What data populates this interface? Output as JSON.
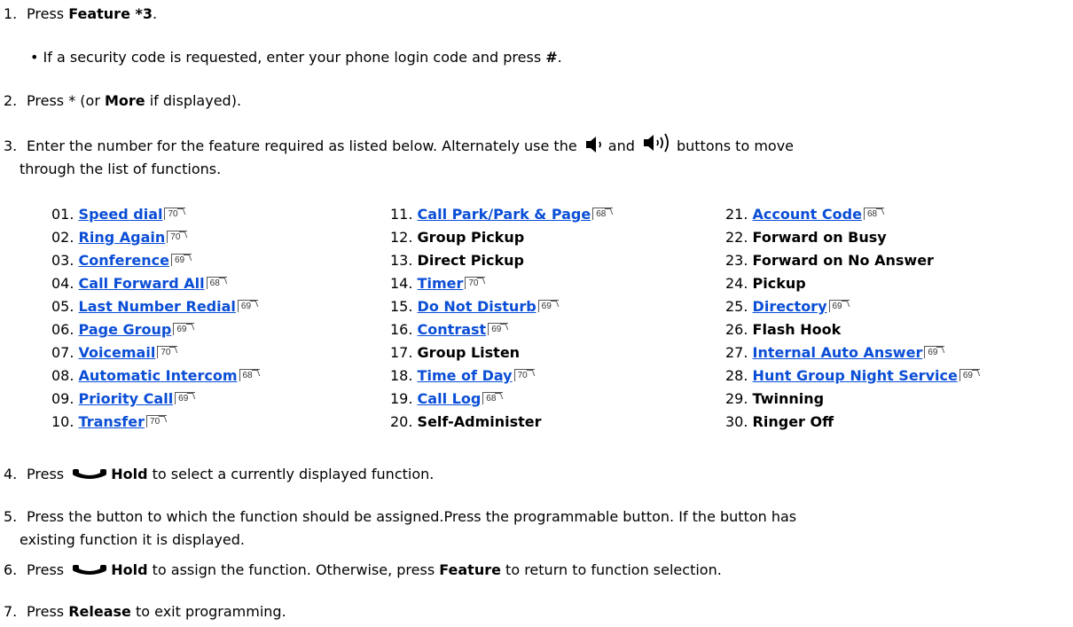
{
  "steps": {
    "s1": {
      "num": "1.",
      "pre": "Press ",
      "bold": "Feature *3",
      "post": "."
    },
    "s1_bullet": {
      "pre": "If a security code is requested, enter your phone login code and press ",
      "bold": "#",
      "post": "."
    },
    "s2": {
      "num": "2.",
      "pre": "Press * (or ",
      "bold": "More",
      "post": " if displayed)."
    },
    "s3": {
      "num": "3.",
      "pre": "Enter the number for the feature required as listed below. Alternately use the ",
      "mid": "and",
      "post": "buttons to move",
      "cont": "through the list of functions."
    },
    "s4": {
      "num": "4.",
      "pre": "Press ",
      "bold": "Hold",
      "post": " to select a currently displayed function."
    },
    "s5": {
      "num": "5.",
      "line1": "Press the button to which the function should be assigned.Press the programmable button. If the button has",
      "line2": "existing function it is displayed."
    },
    "s6": {
      "num": "6.",
      "pre": "Press ",
      "bold": "Hold",
      "mid": " to assign the function. Otherwise, press ",
      "bold2": "Feature",
      "post": " to return to function selection."
    },
    "s7": {
      "num": "7.",
      "pre": "Press ",
      "bold": "Release",
      "post": " to exit programming."
    }
  },
  "features": {
    "col1": [
      {
        "n": "01.",
        "label": "Speed dial",
        "ref": "70"
      },
      {
        "n": "02.",
        "label": "Ring Again",
        "ref": "70"
      },
      {
        "n": "03.",
        "label": "Conference",
        "ref": "69"
      },
      {
        "n": "04.",
        "label": "Call Forward All",
        "ref": "68"
      },
      {
        "n": "05.",
        "label": "Last Number Redial",
        "ref": "69"
      },
      {
        "n": "06.",
        "label": "Page Group",
        "ref": "69"
      },
      {
        "n": "07.",
        "label": "Voicemail",
        "ref": "70"
      },
      {
        "n": "08.",
        "label": "Automatic Intercom",
        "ref": "68"
      },
      {
        "n": "09.",
        "label": "Priority Call",
        "ref": "69"
      },
      {
        "n": "10.",
        "label": "Transfer",
        "ref": "70"
      }
    ],
    "col2": [
      {
        "n": "11.",
        "label": "Call Park/Park & Page",
        "ref": "68"
      },
      {
        "n": "12.",
        "label": "Group Pickup",
        "ref": ""
      },
      {
        "n": "13.",
        "label": "Direct Pickup",
        "ref": ""
      },
      {
        "n": "14.",
        "label": "Timer",
        "ref": "70"
      },
      {
        "n": "15.",
        "label": "Do Not Disturb",
        "ref": "69"
      },
      {
        "n": "16.",
        "label": "Contrast",
        "ref": "69"
      },
      {
        "n": "17.",
        "label": "Group Listen",
        "ref": ""
      },
      {
        "n": "18.",
        "label": "Time of Day",
        "ref": "70"
      },
      {
        "n": "19.",
        "label": "Call Log",
        "ref": "68"
      },
      {
        "n": "20.",
        "label": "Self-Administer",
        "ref": ""
      }
    ],
    "col3": [
      {
        "n": "21.",
        "label": "Account Code",
        "ref": "68"
      },
      {
        "n": "22.",
        "label": "Forward on Busy",
        "ref": ""
      },
      {
        "n": "23.",
        "label": "Forward on No Answer",
        "ref": ""
      },
      {
        "n": "24.",
        "label": "Pickup",
        "ref": ""
      },
      {
        "n": "25.",
        "label": "Directory",
        "ref": "69"
      },
      {
        "n": "26.",
        "label": "Flash Hook",
        "ref": ""
      },
      {
        "n": "27.",
        "label": "Internal Auto Answer",
        "ref": "69"
      },
      {
        "n": "28.",
        "label": "Hunt Group Night Service",
        "ref": "69"
      },
      {
        "n": "29.",
        "label": "Twinning",
        "ref": ""
      },
      {
        "n": "30.",
        "label": "Ringer Off",
        "ref": ""
      }
    ]
  },
  "colors": {
    "link": "#0b4ed6",
    "text": "#000000"
  },
  "icons": [
    "volume-down-icon",
    "volume-up-icon",
    "hold-handset-icon",
    "page-reference-icon"
  ]
}
